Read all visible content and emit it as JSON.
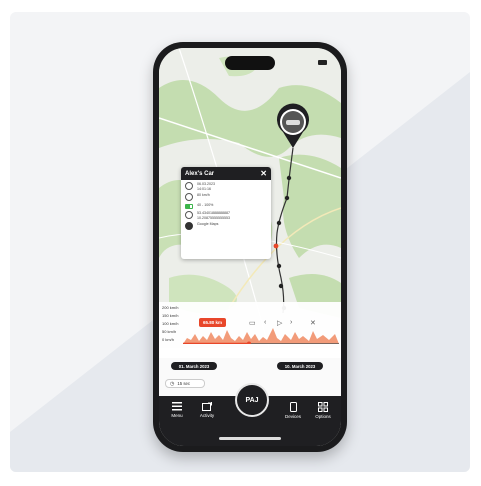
{
  "popup": {
    "title": "Alex's Car",
    "datetime": "06.03.2023\n14:01:16",
    "speed": "80 km/h",
    "battery": "40 - 100%",
    "coords": "53.43401888888887\n10.20875555555553",
    "maps_link": "Google Maps"
  },
  "speed_chart": {
    "y_labels": [
      "200 km/h",
      "150 km/h",
      "100 km/h",
      "50 km/h",
      "0 km/h"
    ],
    "distance": "65.80 km"
  },
  "dates": {
    "start": "01. March 2023",
    "end": "10. March 2023"
  },
  "interval": "15 sec",
  "nav": {
    "menu": "Menu",
    "activity": "Activity",
    "brand": "PAJ",
    "devices": "Devices",
    "options": "Options"
  },
  "colors": {
    "accent": "#e8472a",
    "dark": "#1f1f22",
    "map_green": "#c4ddb0"
  }
}
